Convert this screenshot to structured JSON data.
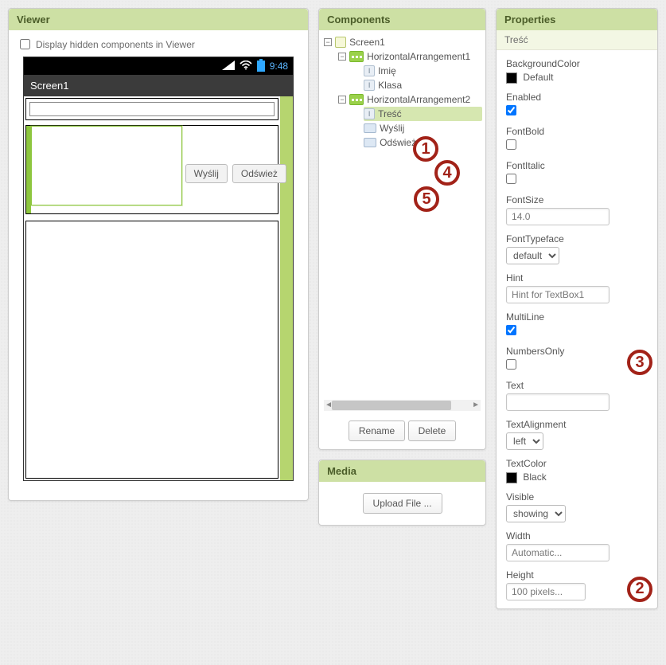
{
  "viewer": {
    "header": "Viewer",
    "hidden_checkbox_label": "Display hidden components in Viewer",
    "hidden_checked": false,
    "phone": {
      "time": "9:48",
      "screen_title": "Screen1",
      "buttons": {
        "send": "Wyślij",
        "refresh": "Odśwież"
      }
    }
  },
  "components": {
    "header": "Components",
    "tree": {
      "screen": "Screen1",
      "ha1": "HorizontalArrangement1",
      "ha1_children": {
        "imie": "Imię",
        "klasa": "Klasa"
      },
      "ha2": "HorizontalArrangement2",
      "ha2_children": {
        "tresc": "Treść",
        "wyslij": "Wyślij",
        "odswiez": "Odśwież"
      }
    },
    "selected": "Treść",
    "buttons": {
      "rename": "Rename",
      "delete": "Delete"
    }
  },
  "media": {
    "header": "Media",
    "upload": "Upload File ..."
  },
  "properties": {
    "header": "Properties",
    "selected_component": "Treść",
    "fields": {
      "BackgroundColor": {
        "label": "BackgroundColor",
        "value": "Default"
      },
      "Enabled": {
        "label": "Enabled",
        "checked": true
      },
      "FontBold": {
        "label": "FontBold",
        "checked": false
      },
      "FontItalic": {
        "label": "FontItalic",
        "checked": false
      },
      "FontSize": {
        "label": "FontSize",
        "value": "14.0"
      },
      "FontTypeface": {
        "label": "FontTypeface",
        "value": "default"
      },
      "Hint": {
        "label": "Hint",
        "value": "Hint for TextBox1"
      },
      "MultiLine": {
        "label": "MultiLine",
        "checked": true
      },
      "NumbersOnly": {
        "label": "NumbersOnly",
        "checked": false
      },
      "Text": {
        "label": "Text",
        "value": ""
      },
      "TextAlignment": {
        "label": "TextAlignment",
        "value": "left"
      },
      "TextColor": {
        "label": "TextColor",
        "value": "Black"
      },
      "Visible": {
        "label": "Visible",
        "value": "showing"
      },
      "Width": {
        "label": "Width",
        "value": "Automatic..."
      },
      "Height": {
        "label": "Height",
        "value": "100 pixels..."
      }
    }
  },
  "callouts": {
    "c1": "1",
    "c2": "2",
    "c3": "3",
    "c4": "4",
    "c5": "5"
  }
}
